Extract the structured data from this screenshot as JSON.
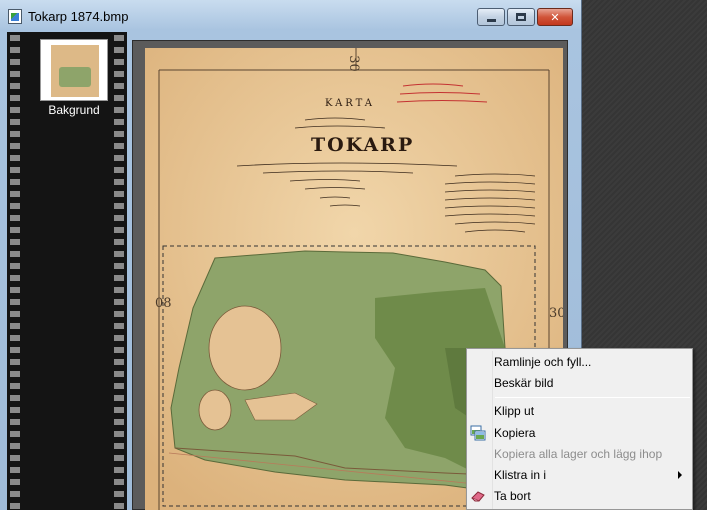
{
  "window": {
    "title": "Tokarp 1874.bmp",
    "buttons": {
      "minimize": "minimize-icon",
      "maximize": "maximize-icon",
      "close": "close-icon"
    },
    "close_glyph": "✕"
  },
  "layers": {
    "items": [
      {
        "name": "Bakgrund"
      }
    ]
  },
  "map": {
    "heading": "KARTA",
    "place": "TOKARP",
    "margin_number_top": "30",
    "margin_number_left": "08",
    "margin_number_right": "30"
  },
  "context_menu": {
    "items": [
      {
        "label": "Ramlinje och fyll...",
        "disabled": false
      },
      {
        "label": "Beskär bild",
        "disabled": false
      },
      {
        "label": "Klipp ut",
        "disabled": false
      },
      {
        "label": "Kopiera",
        "disabled": false,
        "icon": "copy-icon"
      },
      {
        "label": "Kopiera alla lager och lägg ihop",
        "disabled": true
      },
      {
        "label": "Klistra in i",
        "disabled": false,
        "submenu": true
      },
      {
        "label": "Ta bort",
        "disabled": false,
        "icon": "eraser-icon"
      }
    ]
  },
  "colors": {
    "paper": "#e9c89a",
    "forest": "#8ea46a",
    "selection": "#333333"
  }
}
